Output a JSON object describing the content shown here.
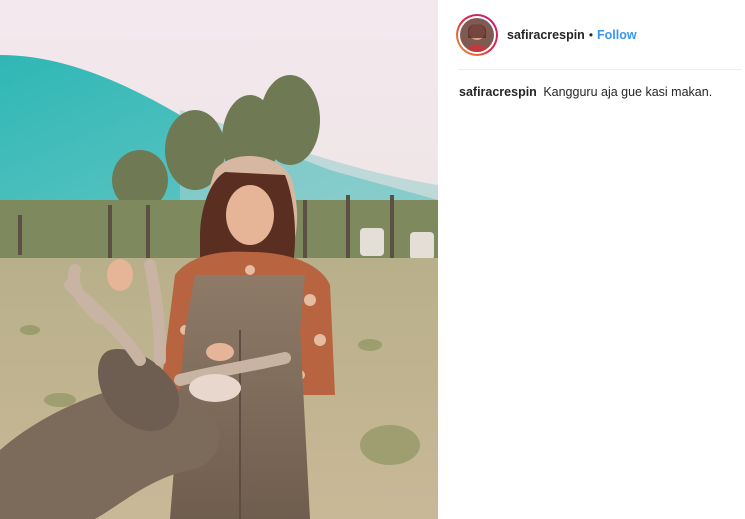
{
  "post": {
    "image_alt": "",
    "author": {
      "username": "safiracrespin",
      "separator": "•",
      "follow_label": "Follow"
    },
    "caption": {
      "username": "safiracrespin",
      "text": "Kangguru aja gue kasi makan."
    }
  },
  "colors": {
    "follow_blue": "#3897f0",
    "text": "#262626",
    "divider": "#efefef"
  }
}
